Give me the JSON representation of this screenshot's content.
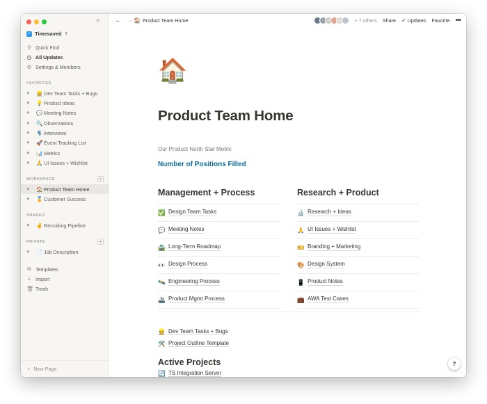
{
  "sidebar": {
    "workspace_name": "Timesaved",
    "workspace_caret": "⬍",
    "collapse_icon": "«",
    "nav": [
      {
        "label": "Quick Find",
        "icon": "search-icon"
      },
      {
        "label": "All Updates",
        "icon": "clock-icon",
        "active": true
      },
      {
        "label": "Settings & Members",
        "icon": "gear-icon"
      }
    ],
    "favorites_label": "FAVORITES",
    "favorites": [
      {
        "emoji": "👷",
        "label": "Dev Team Tasks + Bugs"
      },
      {
        "emoji": "💡",
        "label": "Product Ideas"
      },
      {
        "emoji": "💬",
        "label": "Meeting Notes"
      },
      {
        "emoji": "🔍",
        "label": "Observations"
      },
      {
        "emoji": "🎙️",
        "label": "Interviews"
      },
      {
        "emoji": "🚀",
        "label": "Event Tracking List"
      },
      {
        "emoji": "📊",
        "label": "Metrics"
      },
      {
        "emoji": "🙏",
        "label": "UI Issues + Wishlist"
      }
    ],
    "workspace_label": "WORKSPACE",
    "workspace_pages": [
      {
        "emoji": "🏠",
        "label": "Product Team Home",
        "selected": true
      },
      {
        "emoji": "🏅",
        "label": "Customer Success"
      }
    ],
    "shared_label": "SHARED",
    "shared_pages": [
      {
        "emoji": "✌️",
        "label": "Recruiting Pipeline"
      }
    ],
    "private_label": "PRIVATE",
    "private_pages": [
      {
        "emoji": "📄",
        "label": "Job Description"
      }
    ],
    "tools": [
      {
        "label": "Templates",
        "icon": "templates-icon"
      },
      {
        "label": "Import",
        "icon": "import-icon"
      },
      {
        "label": "Trash",
        "icon": "trash-icon"
      }
    ],
    "new_page_label": "New Page",
    "plus": "+"
  },
  "topbar": {
    "breadcrumb_emoji": "🏠",
    "breadcrumb": "Product Team Home",
    "others": "+ 7 others",
    "share": "Share",
    "updates": "Updates",
    "favorite": "Favorite",
    "more": "•••",
    "avatars": [
      {
        "initial": "",
        "color": "#6b7a8a"
      },
      {
        "initial": "",
        "color": "#9aa3ad"
      },
      {
        "initial": "S",
        "color": "#c9c6c0"
      },
      {
        "initial": "",
        "color": "#e4a48f"
      },
      {
        "initial": "A",
        "color": "#d7d5d0"
      },
      {
        "initial": "",
        "color": "#bfc4c9"
      }
    ]
  },
  "page": {
    "icon": "🏠",
    "title": "Product Team Home",
    "metric_label": "Our Product North Star Metric",
    "metric_link": "Number of Positions Filled",
    "left_column": {
      "heading": "Management + Process",
      "links": [
        {
          "emoji": "✅",
          "label": "Design Team Tasks"
        },
        {
          "emoji": "💬",
          "label": "Meeting Notes"
        },
        {
          "emoji": "🛣️",
          "label": "Long-Term Roadmap"
        },
        {
          "emoji": "👀",
          "label": "Design Process"
        },
        {
          "emoji": "🛰️",
          "label": "Engineering Process"
        },
        {
          "emoji": "🚢",
          "label": "Product Mgmt Process"
        }
      ]
    },
    "right_column": {
      "heading": "Research + Product",
      "links": [
        {
          "emoji": "🔬",
          "label": "Research + Ideas"
        },
        {
          "emoji": "🙏",
          "label": "UI Issues + Wishlist"
        },
        {
          "emoji": "🎫",
          "label": "Branding + Marketing"
        },
        {
          "emoji": "🎨",
          "label": "Design System"
        },
        {
          "emoji": "📱",
          "label": "Product Notes"
        },
        {
          "emoji": "💼",
          "label": "AWA Test Cases"
        }
      ]
    },
    "extra_links": [
      {
        "emoji": "👷",
        "label": "Dev Team Tasks + Bugs"
      },
      {
        "emoji": "🛠️",
        "label": "Project Outline Template"
      }
    ],
    "active_projects_heading": "Active Projects",
    "active_project_first": {
      "emoji": "🔄",
      "label": "TS Integration Server"
    },
    "help": "?"
  }
}
